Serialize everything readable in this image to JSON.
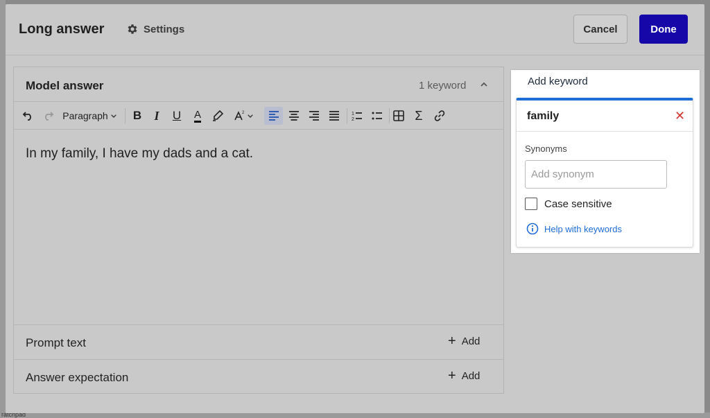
{
  "background": {
    "fragment": "ratchpad"
  },
  "header": {
    "title": "Long answer",
    "settings_label": "Settings",
    "cancel_label": "Cancel",
    "done_label": "Done"
  },
  "editor": {
    "label": "Model answer",
    "keyword_count": "1 keyword",
    "toolbar": {
      "paragraph_label": "Paragraph",
      "bold": "B",
      "italic": "I",
      "underline": "U",
      "font_color": "A",
      "sigma": "Σ"
    },
    "content": "In my family, I have my dads and a cat."
  },
  "rows": [
    {
      "label": "Prompt text",
      "action": "Add"
    },
    {
      "label": "Answer expectation",
      "action": "Add"
    }
  ],
  "keyword_panel": {
    "add_keyword_label": "Add keyword",
    "keyword": "family",
    "close_glyph": "✕",
    "synonyms_label": "Synonyms",
    "synonym_placeholder": "Add synonym",
    "case_sensitive_label": "Case sensitive",
    "help_label": "Help with keywords"
  },
  "colors": {
    "accent": "#1f6dd6",
    "done_button": "#1507a8",
    "close_icon": "#d0342c"
  }
}
